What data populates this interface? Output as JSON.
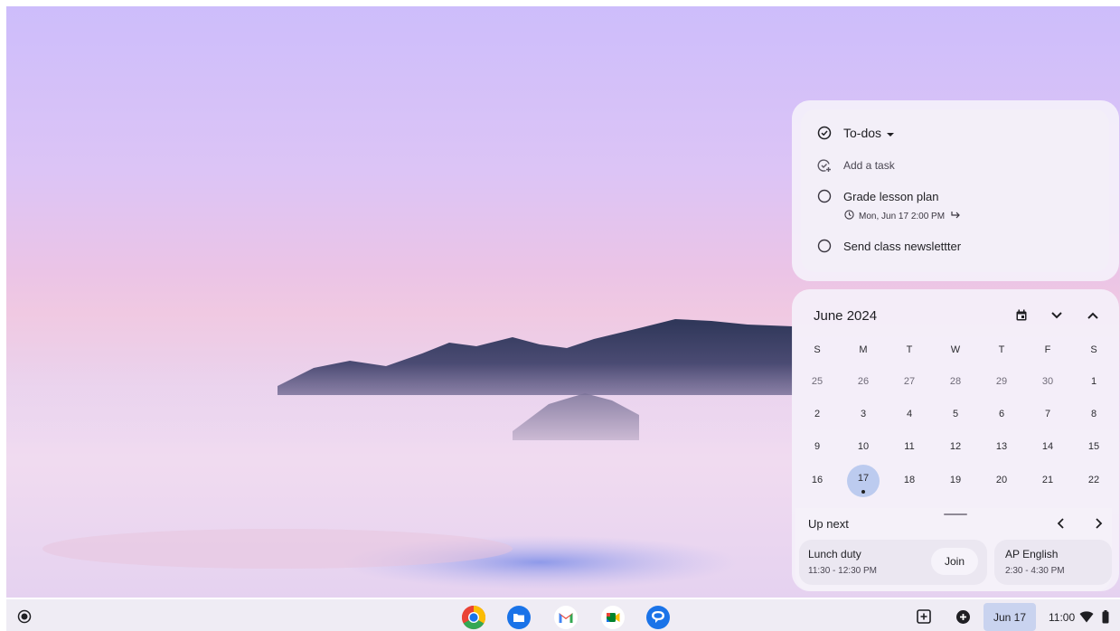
{
  "tasks": {
    "header": "To-dos",
    "add_placeholder": "Add a task",
    "items": [
      {
        "title": "Grade lesson plan",
        "due": "Mon, Jun 17  2:00 PM"
      },
      {
        "title": "Send class newslettter"
      }
    ]
  },
  "calendar": {
    "month_label": "June 2024",
    "weekdays": [
      "S",
      "M",
      "T",
      "W",
      "T",
      "F",
      "S"
    ],
    "weeks": [
      [
        "25",
        "26",
        "27",
        "28",
        "29",
        "30",
        "1"
      ],
      [
        "2",
        "3",
        "4",
        "5",
        "6",
        "7",
        "8"
      ],
      [
        "9",
        "10",
        "11",
        "12",
        "13",
        "14",
        "15"
      ],
      [
        "16",
        "17",
        "18",
        "19",
        "20",
        "21",
        "22"
      ]
    ],
    "today": "17"
  },
  "up_next": {
    "label": "Up next",
    "events": [
      {
        "title": "Lunch duty",
        "time": "11:30 - 12:30 PM",
        "action": "Join"
      },
      {
        "title": "AP English",
        "time": "2:30 - 4:30 PM"
      }
    ]
  },
  "shelf": {
    "apps": [
      "chrome-icon",
      "files-icon",
      "gmail-icon",
      "meet-icon",
      "messages-icon"
    ],
    "date": "Jun 17",
    "time": "11:00"
  },
  "colors": {
    "today_highlight": "#bccbef",
    "date_chip": "#c9d3ef"
  }
}
